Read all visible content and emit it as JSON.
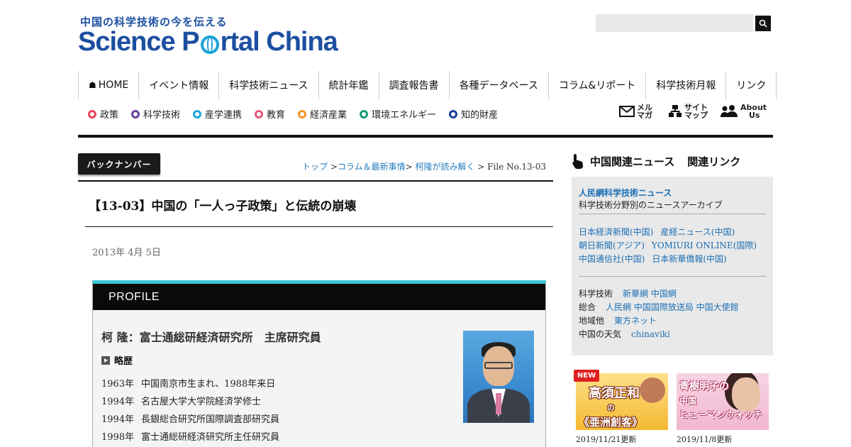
{
  "header": {
    "tagline": "中国の科学技術の今を伝える",
    "logo_part1": "Science P",
    "logo_part2": "rtal China",
    "search_placeholder": ""
  },
  "mainnav": [
    "HOME",
    "イベント情報",
    "科学技術ニュース",
    "統計年鑑",
    "調査報告書",
    "各種データベース",
    "コラム&リポート",
    "科学技術月報",
    "リンク"
  ],
  "subnav": [
    {
      "label": "政策",
      "color": "#e8435a"
    },
    {
      "label": "科学技術",
      "color": "#6a3fa0"
    },
    {
      "label": "産学連携",
      "color": "#1fa8d8"
    },
    {
      "label": "教育",
      "color": "#e85a7a"
    },
    {
      "label": "経済産業",
      "color": "#f0962a"
    },
    {
      "label": "環境エネルギー",
      "color": "#1a9a7a"
    },
    {
      "label": "知的財産",
      "color": "#1c3f9a"
    }
  ],
  "quicklinks": [
    {
      "line1": "メル",
      "line2": "マガ"
    },
    {
      "line1": "サイト",
      "line2": "マップ"
    },
    {
      "line1": "About",
      "line2": "Us"
    }
  ],
  "article": {
    "backnumber_label": "バックナンバー",
    "breadcrumb": [
      "トップ",
      "コラム＆最新事情",
      "柯隆が読み解く"
    ],
    "breadcrumb_current": "File No.13-03",
    "title": "【13-03】中国の「一人っ子政策」と伝統の崩壊",
    "date": "2013年 4月 5日"
  },
  "profile": {
    "heading": "PROFILE",
    "name": "柯 隆：富士通総研経済研究所　主席研究員",
    "career_label": "略歴",
    "career": [
      {
        "year": "1963年",
        "text": "中国南京市生まれ、1988年来日"
      },
      {
        "year": "1994年",
        "text": "名古屋大学大学院経済学修士"
      },
      {
        "year": "1994年",
        "text": "長銀総合研究所国際調査部研究員"
      },
      {
        "year": "1998年",
        "text": "富士通総研経済研究所主任研究員"
      }
    ]
  },
  "sidebar": {
    "heading1": "中国関連ニュース",
    "heading2": "関連リンク",
    "featured_link": "人民網科学技術ニュース",
    "featured_desc": "科学技術分野別のニュースアーカイブ",
    "news_links": [
      [
        "日本経済新聞(中国)",
        "産経ニュース(中国)"
      ],
      [
        "朝日新聞(アジア)",
        "YOMIURI ONLINE(国際)"
      ],
      [
        "中国通信社(中国)",
        "日本新華僑報(中国)"
      ]
    ],
    "categories": [
      {
        "label": "科学技術",
        "links": "新華網 中国網"
      },
      {
        "label": "総合",
        "links": "人民網 中国国際放送局 中国大使館"
      },
      {
        "label": "地域他",
        "links": "東方ネット"
      },
      {
        "label": "中国の天気",
        "links": "chinaviki"
      }
    ],
    "banners": [
      {
        "badge": "NEW",
        "t1": "高須正和",
        "t2": "の",
        "t3": "《亜洲創客》",
        "date": "2019/11/21更新"
      },
      {
        "t1": "青樹明子の",
        "t2": "中国",
        "t3": "ヒューマンウォッチ",
        "date": "2019/11/8更新"
      }
    ]
  }
}
